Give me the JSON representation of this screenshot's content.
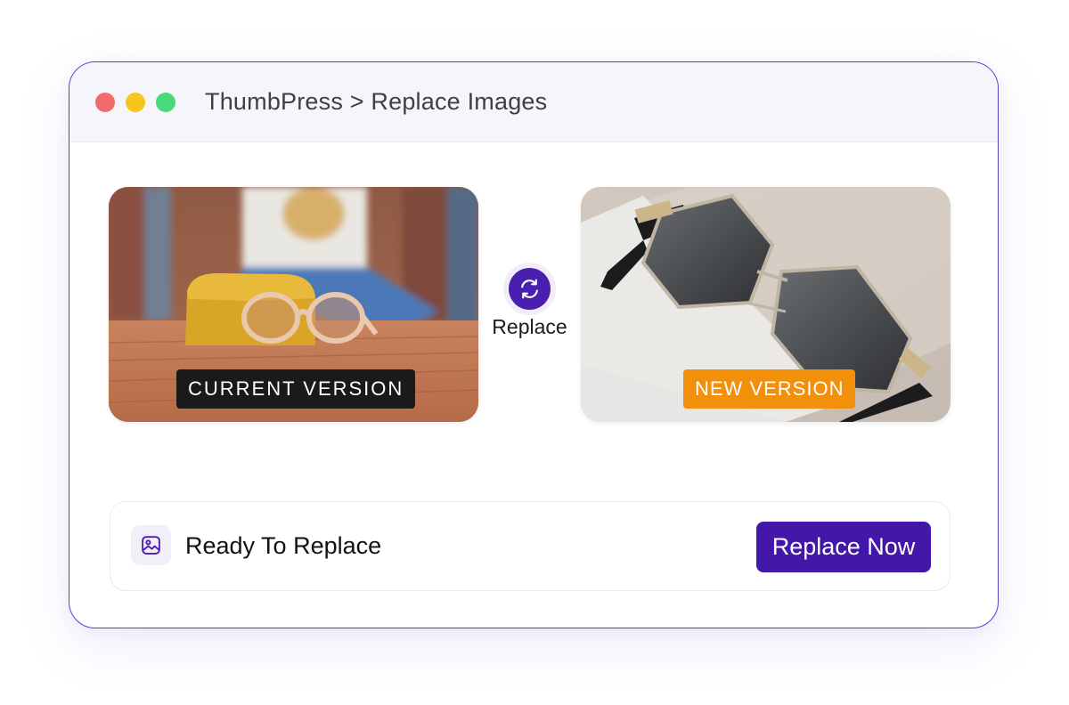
{
  "window": {
    "title": "ThumbPress > Replace Images",
    "controls": [
      "close",
      "minimize",
      "maximize"
    ]
  },
  "images": {
    "current": {
      "badge": "CURRENT VERSION",
      "badge_color": "#1a1a1a",
      "icon": "sunglasses-on-case-photo"
    },
    "new": {
      "badge": "NEW VERSION",
      "badge_color": "#f28f0b",
      "icon": "hexagon-sunglasses-photo"
    }
  },
  "swap": {
    "label": "Replace",
    "icon": "refresh-icon",
    "color": "#4a1fb0"
  },
  "status": {
    "text": "Ready To Replace",
    "icon": "image-icon",
    "button_label": "Replace Now",
    "button_color": "#4318a8"
  },
  "colors": {
    "accent": "#4318a8",
    "window_border": "#5b3fc4"
  }
}
